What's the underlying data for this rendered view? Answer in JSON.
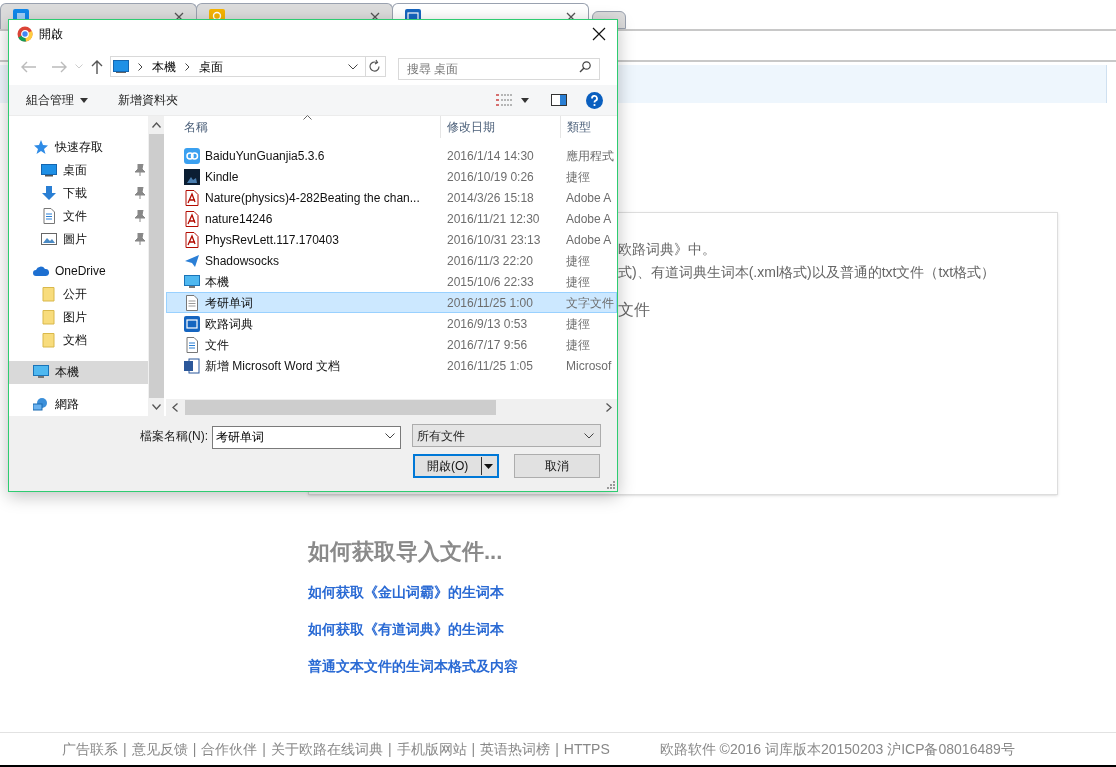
{
  "browser": {
    "tabs": [
      {
        "kind": "zhihu",
        "selected": false
      },
      {
        "kind": "keep",
        "selected": false
      },
      {
        "kind": "eudic",
        "selected": true
      }
    ]
  },
  "dialog": {
    "title": "開啟",
    "breadcrumb": [
      "本機",
      "桌面"
    ],
    "search": {
      "placeholder": "搜尋 桌面"
    },
    "commands": [
      {
        "label": "組合管理",
        "dropdown": true
      },
      {
        "label": "新增資料夾",
        "dropdown": false
      }
    ],
    "sidebar": {
      "items": [
        {
          "label": "快速存取",
          "kind": "star",
          "selected": false,
          "children": [
            {
              "label": "桌面",
              "kind": "desktop",
              "pinned": true,
              "selected": false
            },
            {
              "label": "下載",
              "kind": "download",
              "pinned": true,
              "selected": false
            },
            {
              "label": "文件",
              "kind": "document",
              "pinned": true,
              "selected": false
            },
            {
              "label": "圖片",
              "kind": "image",
              "pinned": true,
              "selected": false
            }
          ]
        },
        {
          "label": "OneDrive",
          "kind": "cloud",
          "selected": false,
          "children": [
            {
              "label": "公开",
              "kind": "folder",
              "pinned": false,
              "selected": false
            },
            {
              "label": "图片",
              "kind": "folder",
              "pinned": false,
              "selected": false
            },
            {
              "label": "文档",
              "kind": "folder",
              "pinned": false,
              "selected": false
            }
          ]
        },
        {
          "label": "本機",
          "kind": "computer",
          "selected": true
        },
        {
          "label": "網路",
          "kind": "network",
          "selected": false
        }
      ]
    },
    "table": {
      "columns": [
        "名稱",
        "修改日期",
        "類型"
      ],
      "rows": [
        {
          "name": "BaiduYunGuanjia5.3.6",
          "date": "2016/1/14 14:30",
          "type": "應用程式",
          "kind": "app",
          "selected": false
        },
        {
          "name": "Kindle",
          "date": "2016/10/19 0:26",
          "type": "捷徑",
          "kind": "kindle",
          "selected": false
        },
        {
          "name": "Nature(physics)4-282Beating the chan...",
          "date": "2014/3/26 15:18",
          "type": "Adobe A",
          "kind": "pdf",
          "selected": false
        },
        {
          "name": "nature14246",
          "date": "2016/11/21 12:30",
          "type": "Adobe A",
          "kind": "pdf",
          "selected": false
        },
        {
          "name": "PhysRevLett.117.170403",
          "date": "2016/10/31 23:13",
          "type": "Adobe A",
          "kind": "pdf",
          "selected": false
        },
        {
          "name": "Shadowsocks",
          "date": "2016/11/3 22:20",
          "type": "捷徑",
          "kind": "plane",
          "selected": false
        },
        {
          "name": "本機",
          "date": "2015/10/6 22:33",
          "type": "捷徑",
          "kind": "computer",
          "selected": false
        },
        {
          "name": "考研单词",
          "date": "2016/11/25 1:00",
          "type": "文字文件",
          "kind": "text",
          "selected": true
        },
        {
          "name": "欧路词典",
          "date": "2016/9/13 0:53",
          "type": "捷徑",
          "kind": "eudic",
          "selected": false
        },
        {
          "name": "文件",
          "date": "2016/7/17 9:56",
          "type": "捷徑",
          "kind": "document",
          "selected": false
        },
        {
          "name": "新增 Microsoft Word 文档",
          "date": "2016/11/25 1:05",
          "type": "Microsof",
          "kind": "word",
          "selected": false
        }
      ]
    },
    "filename": {
      "label": "檔案名稱(N):",
      "value": "考研单词"
    },
    "filter": "所有文件",
    "buttons": [
      "開啟(O)",
      "取消"
    ]
  },
  "page": {
    "card_lines": [
      "欧路词典》中。",
      "式)、有道词典生词本(.xml格式)以及普通的txt文件（txt格式）",
      "文件"
    ],
    "heading": "如何获取导入文件...",
    "links": [
      "如何获取《金山词霸》的生词本",
      "如何获取《有道词典》的生词本",
      "普通文本文件的生词本格式及内容"
    ],
    "footer_links": [
      "广告联系",
      "意见反馈",
      "合作伙伴",
      "关于欧路在线词典",
      "手机版网站",
      "英语热词榜",
      "HTTPS"
    ],
    "footer_separator": "|",
    "copyright": "欧路软件 ©2016 词库版本20150203 沪ICP备08016489号"
  }
}
